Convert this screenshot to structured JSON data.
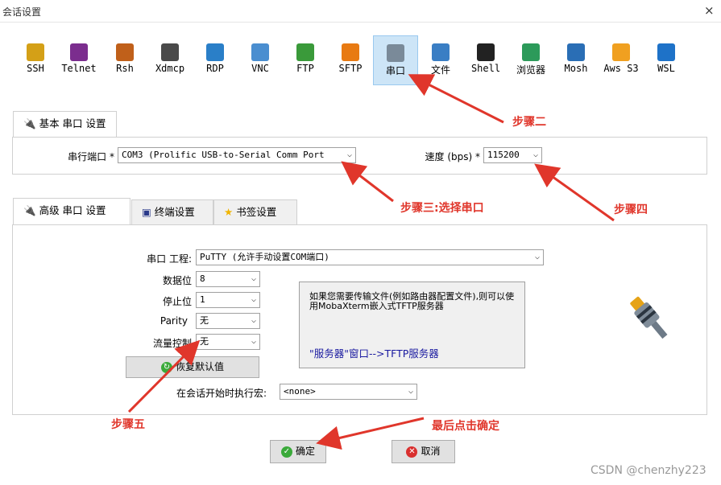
{
  "window": {
    "title": "会话设置",
    "close_glyph": "×"
  },
  "protocols": [
    {
      "label": "SSH",
      "color": "#d4a017"
    },
    {
      "label": "Telnet",
      "color": "#7b2d8e"
    },
    {
      "label": "Rsh",
      "color": "#c0601a"
    },
    {
      "label": "Xdmcp",
      "color": "#4a4a4a"
    },
    {
      "label": "RDP",
      "color": "#2a7fc8"
    },
    {
      "label": "VNC",
      "color": "#4a8ed0"
    },
    {
      "label": "FTP",
      "color": "#3a9a3a"
    },
    {
      "label": "SFTP",
      "color": "#e87a12"
    },
    {
      "label": "串口",
      "color": "#7a8a99"
    },
    {
      "label": "文件",
      "color": "#3a7ec4"
    },
    {
      "label": "Shell",
      "color": "#222222"
    },
    {
      "label": "浏览器",
      "color": "#2c9a5a"
    },
    {
      "label": "Mosh",
      "color": "#2a6eb5"
    },
    {
      "label": "Aws S3",
      "color": "#f0a020"
    },
    {
      "label": "WSL",
      "color": "#1e72c8"
    }
  ],
  "basic": {
    "tab_label": "基本 串口 设置",
    "port_label": "串行端口 *",
    "port_value": "COM3  (Prolific USB-to-Serial Comm Port",
    "speed_label": "速度 (bps) *",
    "speed_value": "115200"
  },
  "advanced": {
    "tabs": [
      "高级 串口 设置",
      "终端设置",
      "书签设置"
    ],
    "engine_label": "串口 工程:",
    "engine_value": "PuTTY  (允许手动设置COM端口)",
    "databits_label": "数据位",
    "databits_value": "8",
    "stopbits_label": "停止位",
    "stopbits_value": "1",
    "parity_label": "Parity",
    "parity_value": "无",
    "flow_label": "流量控制",
    "flow_value": "无",
    "restore_label": "恢复默认值",
    "info_text": "如果您需要传输文件(例如路由器配置文件),则可以使用MobaXterm嵌入式TFTP服务器",
    "info_link": "\"服务器\"窗口-->TFTP服务器",
    "macro_label": "在会话开始时执行宏:",
    "macro_value": "<none>"
  },
  "buttons": {
    "ok": "确定",
    "cancel": "取消"
  },
  "annotations": {
    "step2": "步骤二",
    "step3": "步骤三:选择串口",
    "step4": "步骤四",
    "step5": "步骤五",
    "final": "最后点击确定"
  },
  "watermark": "CSDN @chenzhy223"
}
